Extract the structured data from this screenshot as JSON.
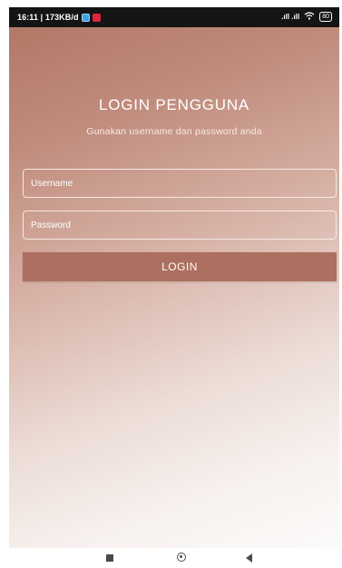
{
  "status_bar": {
    "time_and_speed": "16:11 | 173KB/d",
    "signal_text": ".ıll .ıll",
    "battery": "80"
  },
  "login": {
    "title": "LOGIN PENGGUNA",
    "subtitle": "Gunakan username dan password anda",
    "username_placeholder": "Username",
    "password_placeholder": "Password",
    "button_label": "LOGIN"
  },
  "colors": {
    "gradient_top": "#b07563",
    "gradient_bottom": "#fcfbfa",
    "button": "#ad6f5f"
  },
  "icons": {
    "app_icons": [
      "app-notification-icon",
      "message-app-icon"
    ],
    "wifi": "wifi-icon",
    "nav": [
      "recent-apps-icon",
      "home-icon",
      "back-icon"
    ]
  }
}
